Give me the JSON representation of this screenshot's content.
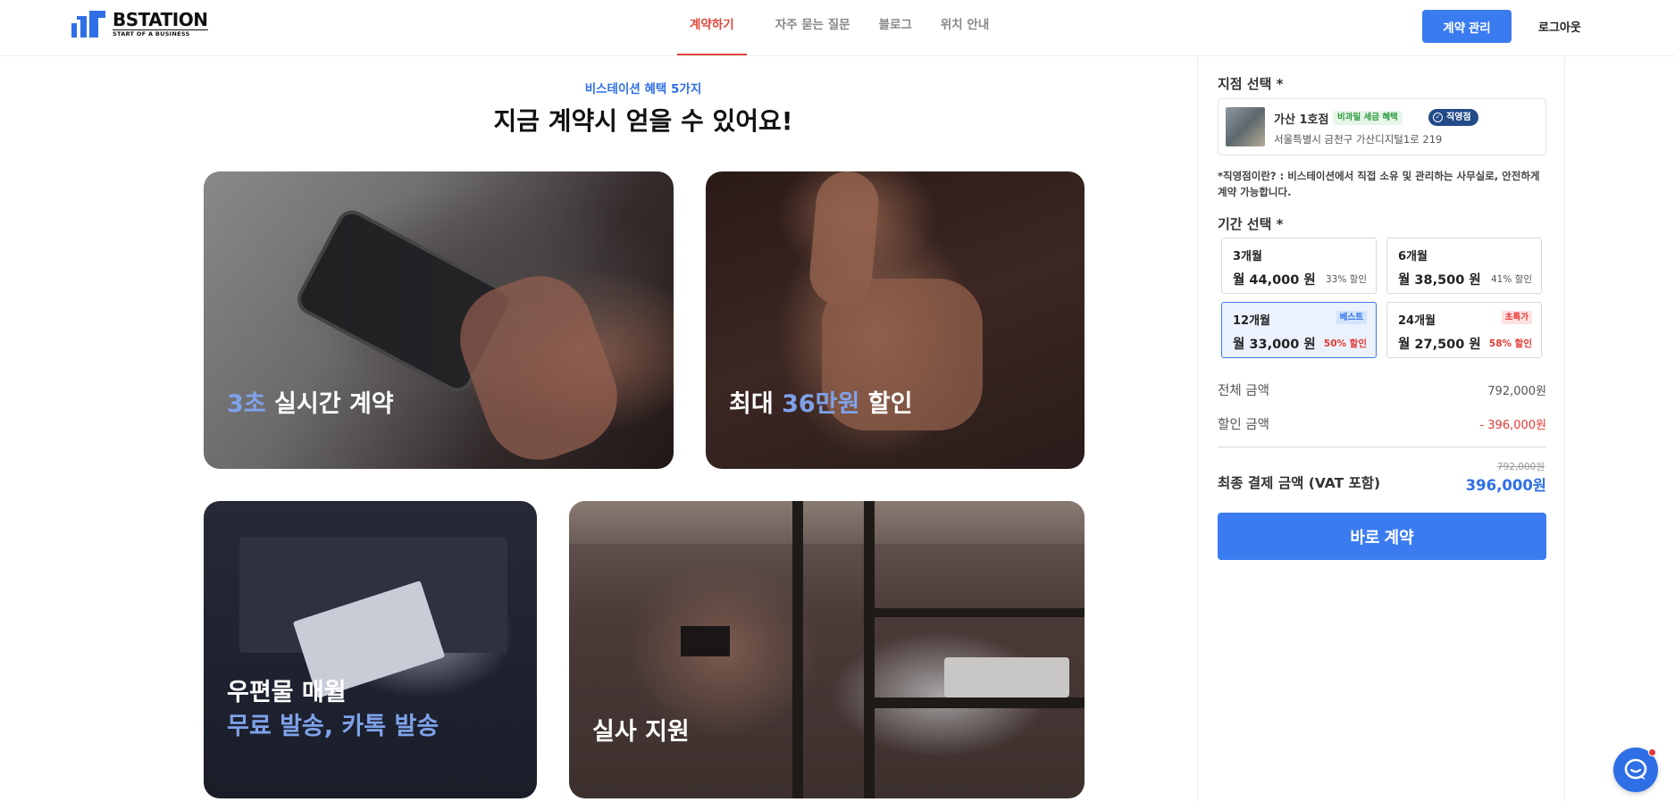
{
  "header": {
    "logo_name": "BSTATION",
    "logo_sub": "START OF A BUSINESS",
    "nav": [
      "계약하기",
      "자주 묻는 질문",
      "블로그",
      "위치 안내"
    ],
    "contract_manage": "계약 관리",
    "logout": "로그아웃"
  },
  "intro": {
    "eyebrow": "비스테이션 혜택 5가지",
    "headline": "지금 계약시 얻을 수 있어요!"
  },
  "cards": {
    "c1_hl": "3초",
    "c1_rest": " 실시간 계약",
    "c2_pre": "최대 ",
    "c2_hl": "36만원",
    "c2_post": " 할인",
    "c3_line1": "우편물 매월",
    "c3_line2": "무료 발송, 카톡 발송",
    "c4_title": "실사 지원"
  },
  "side": {
    "branch_label": "지점 선택 *",
    "branch_name": "가산 1호점",
    "badge_tax": "비과밀 세금 혜택",
    "badge_direct": "직영점",
    "branch_addr": "서울특별시 금천구 가산디지털1로 219",
    "note": "*직영점이란? : 비스테이션에서 직접 소유 및 관리하는 사무실로, 안전하게 계약 가능합니다.",
    "period_label": "기간 선택 *",
    "plans": [
      {
        "name": "3개월",
        "price": "월 44,000 원",
        "disc": "33% 할인",
        "tag": ""
      },
      {
        "name": "6개월",
        "price": "월 38,500 원",
        "disc": "41% 할인",
        "tag": ""
      },
      {
        "name": "12개월",
        "price": "월 33,000 원",
        "disc": "50% 할인",
        "tag": "베스트"
      },
      {
        "name": "24개월",
        "price": "월 27,500 원",
        "disc": "58% 할인",
        "tag": "초특가"
      }
    ],
    "total_label": "전체 금액",
    "total_val": "792,000원",
    "discount_label": "할인 금액",
    "discount_val": "- 396,000원",
    "final_label": "최종 결제 금액 (VAT 포함)",
    "final_orig": "792,000원",
    "final_val": "396,000원",
    "buy": "바로 계약"
  },
  "colors": {
    "accent": "#3a7cf0",
    "nav_active": "#e0473c",
    "discount": "#e53935"
  }
}
